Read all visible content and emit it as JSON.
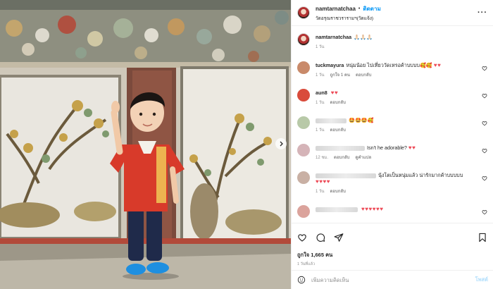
{
  "post": {
    "username": "namtarnatchaa",
    "follow_label": "ติดตาม",
    "location": "วัดอรุณราชวรารามฯ(วัดแจ้ง)",
    "more_icon": "more-horizontal-icon"
  },
  "caption": {
    "username": "namtarnatchaa",
    "text": "🙏🏻🙏🏻🙏🏻",
    "age": "1 วัน"
  },
  "comments": [
    {
      "username": "tuckmayura",
      "text": "หนุ่มน้อย ไปเที่ยววัดเหรอค้าบบบบ🥰🥰",
      "hearts": "♥♥",
      "age": "1 วัน",
      "likes": "ถูกใจ 1 คน",
      "reply": "ตอบกลับ",
      "translate": "",
      "avatar_color": "#c98a6a"
    },
    {
      "username": "aun8",
      "text": "",
      "hearts": "♥♥",
      "age": "1 วัน",
      "likes": "",
      "reply": "ตอบกลับ",
      "translate": "",
      "avatar_color": "#d94b3b"
    },
    {
      "username": "",
      "text": "🤩🤩🤩🥰",
      "hearts": "",
      "age": "1 วัน",
      "likes": "",
      "reply": "ตอบกลับ",
      "translate": "",
      "avatar_color": "#b8c9a8"
    },
    {
      "username": "",
      "text": "Isn't he adorable?",
      "hearts": "♥♥",
      "age": "12 ชม.",
      "likes": "",
      "reply": "ตอบกลับ",
      "translate": "ดูคำแปล",
      "avatar_color": "#d5b4b8"
    },
    {
      "username": "",
      "text": "นุ้งโตเป็นหนุ่มแล้ว น่ารักมากค้าบบบบบ",
      "hearts": "♥♥♥♥",
      "age": "1 วัน",
      "likes": "",
      "reply": "ตอบกลับ",
      "translate": "",
      "avatar_color": "#c9b0a4"
    },
    {
      "username": "",
      "text": "",
      "hearts": "♥♥♥♥♥♥",
      "age": "",
      "likes": "",
      "reply": "",
      "translate": "",
      "avatar_color": "#dba39c"
    }
  ],
  "actions": {
    "like_icon": "heart-icon",
    "comment_icon": "comment-icon",
    "share_icon": "share-icon",
    "save_icon": "bookmark-icon"
  },
  "likes_text": "ถูกใจ 1,665 คน",
  "time_text": "1 วันที่แล้ว",
  "composer": {
    "placeholder": "เพิ่มความคิดเห็น",
    "post_label": "โพสต์"
  },
  "colors": {
    "accent": "#0095f6",
    "heart": "#ed4956",
    "shirt": "#d83a2a",
    "shoes": "#1e8fe0"
  }
}
